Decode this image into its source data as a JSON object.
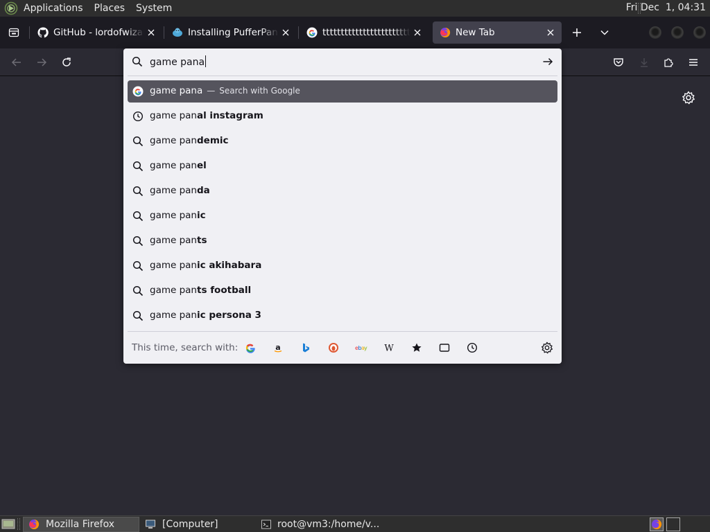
{
  "top_panel": {
    "menus": [
      "Applications",
      "Places",
      "System"
    ],
    "clock": "Fri Dec  1, 04:31"
  },
  "tabs": [
    {
      "title": "GitHub - lordofwizard/",
      "icon": "github-icon"
    },
    {
      "title": "Installing PufferPanel",
      "icon": "pufferpanel-icon"
    },
    {
      "title": "tttttttttttttttttttttttttt",
      "icon": "google-icon"
    },
    {
      "title": "New Tab",
      "icon": "firefox-icon",
      "selected": true
    }
  ],
  "urlbar": {
    "typed": "game pana"
  },
  "results": [
    {
      "icon": "google-icon",
      "typed": "game pana",
      "suffix": "",
      "dash": "—",
      "action": "Search with Google",
      "heuristic": true
    },
    {
      "icon": "history-clock-icon",
      "typed": "game pan",
      "suffix": "al instagram"
    },
    {
      "icon": "search-icon",
      "typed": "game pan",
      "suffix": "demic"
    },
    {
      "icon": "search-icon",
      "typed": "game pan",
      "suffix": "el"
    },
    {
      "icon": "search-icon",
      "typed": "game pan",
      "suffix": "da"
    },
    {
      "icon": "search-icon",
      "typed": "game pan",
      "suffix": "ic"
    },
    {
      "icon": "search-icon",
      "typed": "game pan",
      "suffix": "ts"
    },
    {
      "icon": "search-icon",
      "typed": "game pan",
      "suffix": "ic akihabara"
    },
    {
      "icon": "search-icon",
      "typed": "game pan",
      "suffix": "ts football"
    },
    {
      "icon": "search-icon",
      "typed": "game pan",
      "suffix": "ic persona 3"
    }
  ],
  "one_off": {
    "label": "This time, search with:",
    "engines": [
      "google-icon",
      "amazon-icon",
      "bing-icon",
      "duckduckgo-icon",
      "ebay-icon",
      "wikipedia-icon",
      "bookmarks-star-icon",
      "tabs-icon",
      "history-clock-icon"
    ]
  },
  "taskbar": {
    "items": [
      {
        "label": "Mozilla Firefox",
        "icon": "firefox-icon",
        "active": true
      },
      {
        "label": "[Computer]",
        "icon": "computer-icon",
        "active": false
      },
      {
        "label": "root@vm3:/home/v...",
        "icon": "terminal-icon",
        "active": false
      }
    ]
  },
  "colors": {
    "chrome_dark": "#1c1b22",
    "toolbar": "#2b2a33",
    "selected_tab": "#42414d",
    "popup_bg": "#f0f0f4",
    "heuristic_row": "#55545d"
  }
}
